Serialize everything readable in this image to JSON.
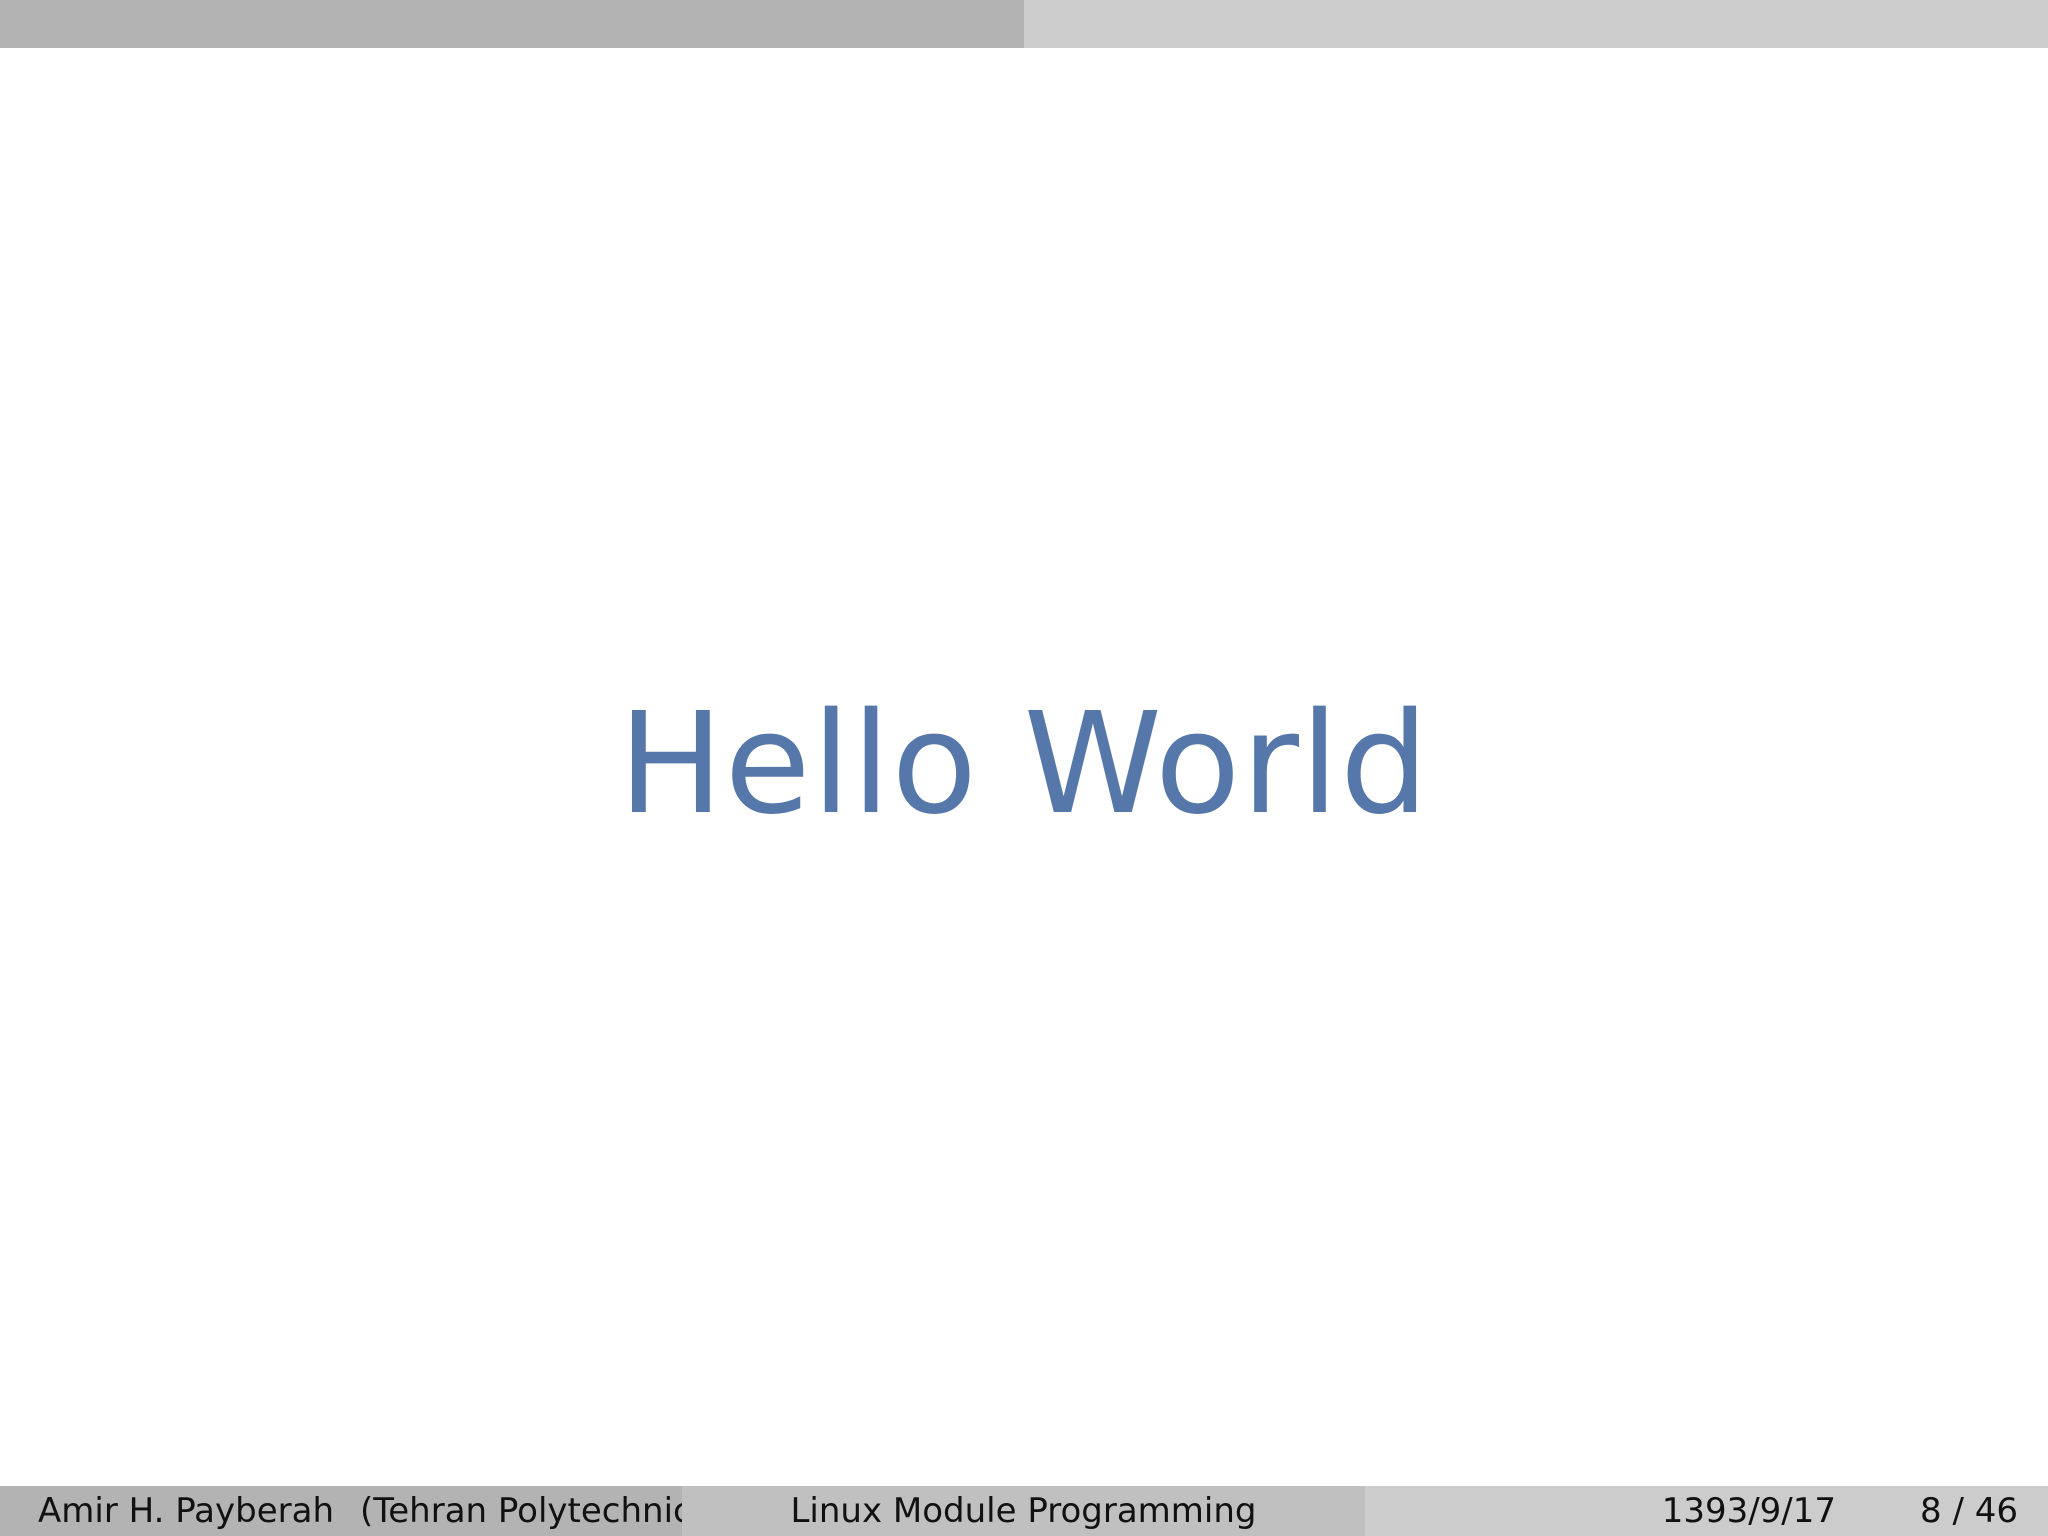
{
  "colors": {
    "header_left": "#b3b3b3",
    "header_right": "#cccccc",
    "footer_left": "#b3b3b3",
    "footer_center": "#c0c0c0",
    "footer_right": "#cccccc",
    "title": "#5577aa"
  },
  "slide": {
    "title": "Hello World"
  },
  "footer": {
    "author": "Amir H. Payberah",
    "institution": "(Tehran Polytechnic)",
    "talk_title": "Linux Module Programming",
    "date": "1393/9/17",
    "page": "8 / 46"
  }
}
